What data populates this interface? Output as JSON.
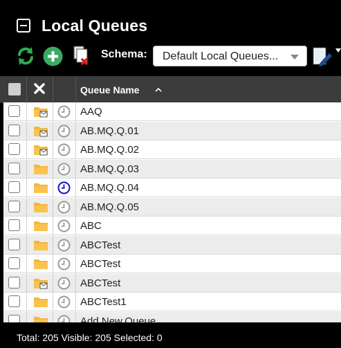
{
  "panel": {
    "title": "Local Queues"
  },
  "toolbar": {
    "schema_label": "Schema:",
    "schema_value": "Default Local Queues..."
  },
  "table": {
    "column_name_header": "Queue Name",
    "rows": [
      {
        "name": "AAQ",
        "folder": "message",
        "clock": "inactive"
      },
      {
        "name": "AB.MQ.Q.01",
        "folder": "message",
        "clock": "inactive"
      },
      {
        "name": "AB.MQ.Q.02",
        "folder": "message",
        "clock": "inactive"
      },
      {
        "name": "AB.MQ.Q.03",
        "folder": "plain",
        "clock": "inactive"
      },
      {
        "name": "AB.MQ.Q.04",
        "folder": "plain",
        "clock": "active"
      },
      {
        "name": "AB.MQ.Q.05",
        "folder": "plain",
        "clock": "inactive"
      },
      {
        "name": "ABC",
        "folder": "plain",
        "clock": "inactive"
      },
      {
        "name": "ABCTest",
        "folder": "plain",
        "clock": "inactive"
      },
      {
        "name": "ABCTest",
        "folder": "plain",
        "clock": "inactive"
      },
      {
        "name": "ABCTest",
        "folder": "message",
        "clock": "inactive"
      },
      {
        "name": "ABCTest1",
        "folder": "plain",
        "clock": "inactive"
      },
      {
        "name": "Add.New.Queue",
        "folder": "plain",
        "clock": "inactive"
      }
    ]
  },
  "status": {
    "text": "Total: 205 Visible: 205 Selected: 0"
  },
  "colors": {
    "refresh": "#2eaa4f",
    "add": "#3caa64",
    "folder": "#f5b63a",
    "clock_inactive": "#9a9a9a",
    "clock_active": "#1010c8"
  }
}
